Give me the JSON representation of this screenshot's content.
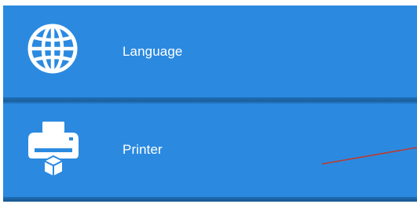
{
  "menu": {
    "items": [
      {
        "label": "Language",
        "icon": "globe-icon"
      },
      {
        "label": "Printer",
        "icon": "printer-icon"
      }
    ]
  },
  "colors": {
    "panel_background": "#2b8ae0",
    "divider": "#1a5f9c",
    "text": "#ffffff",
    "annotation_line": "#c0392b"
  }
}
